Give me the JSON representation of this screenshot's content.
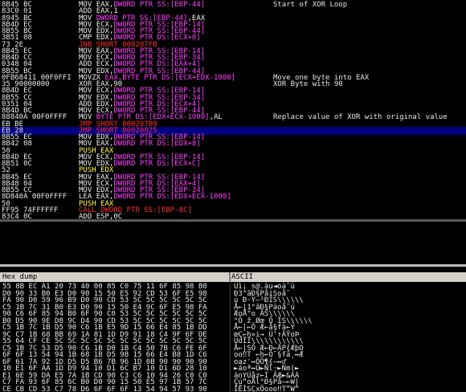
{
  "disassembly": [
    {
      "addr": "8B45 BC",
      "hex": "",
      "ins": [
        [
          "MOV ",
          "#f0f0f0"
        ],
        [
          "EAX,",
          "#f0f0f0"
        ],
        [
          "DWORD PTR SS:[EBP-44]",
          "#ff40ff"
        ]
      ],
      "comment": "Start of XOR Loop"
    },
    {
      "addr": "83C0 01",
      "hex": "",
      "ins": [
        [
          "ADD ",
          "#f0f0f0"
        ],
        [
          "EAX,1",
          "#f0f0f0"
        ]
      ],
      "comment": ""
    },
    {
      "addr": "8945 BC",
      "hex": "",
      "ins": [
        [
          "MOV ",
          "#f0f0f0"
        ],
        [
          "DWORD PTR SS:[EBP-44]",
          "#ff40ff"
        ],
        [
          ",EAX",
          "#f0f0f0"
        ]
      ],
      "comment": ""
    },
    {
      "addr": "8B4D EC",
      "hex": "",
      "ins": [
        [
          "MOV ",
          "#f0f0f0"
        ],
        [
          "ECX,",
          "#f0f0f0"
        ],
        [
          "DWORD PTR SS:[EBP-14]",
          "#ff40ff"
        ]
      ],
      "comment": ""
    },
    {
      "addr": "8B55 BC",
      "hex": "",
      "ins": [
        [
          "MOV ",
          "#f0f0f0"
        ],
        [
          "EDX,",
          "#f0f0f0"
        ],
        [
          "DWORD PTR SS:[EBP-44]",
          "#ff40ff"
        ]
      ],
      "comment": ""
    },
    {
      "addr": "3B51 08",
      "hex": "",
      "ins": [
        [
          "CMP ",
          "#f0f0f0"
        ],
        [
          "EDX,",
          "#f0f0f0"
        ],
        [
          "DWORD PTR DS:[ECX+8]",
          "#ff40ff"
        ]
      ],
      "comment": ""
    },
    {
      "addr": "73 2E",
      "hex": "",
      "ins": [
        [
          "JNB SHORT 000207FB",
          "#ff3030"
        ]
      ],
      "comment": ""
    },
    {
      "addr": "8B45 EC",
      "hex": "",
      "ins": [
        [
          "MOV ",
          "#f0f0f0"
        ],
        [
          "EAX,",
          "#f0f0f0"
        ],
        [
          "DWORD PTR SS:[EBP-14]",
          "#ff40ff"
        ]
      ],
      "comment": ""
    },
    {
      "addr": "8B4D CC",
      "hex": "",
      "ins": [
        [
          "MOV ",
          "#f0f0f0"
        ],
        [
          "ECX,",
          "#f0f0f0"
        ],
        [
          "DWORD PTR SS:[EBP-34]",
          "#ff40ff"
        ]
      ],
      "comment": ""
    },
    {
      "addr": "0348 04",
      "hex": "",
      "ins": [
        [
          "ADD ",
          "#f0f0f0"
        ],
        [
          "ECX,",
          "#f0f0f0"
        ],
        [
          "DWORD PTR DS:[EAX+4]",
          "#ff40ff"
        ]
      ],
      "comment": ""
    },
    {
      "addr": "8B55 BC",
      "hex": "",
      "ins": [
        [
          "MOV ",
          "#f0f0f0"
        ],
        [
          "EDX,",
          "#f0f0f0"
        ],
        [
          "DWORD PTR SS:[EBP-44]",
          "#ff40ff"
        ]
      ],
      "comment": ""
    },
    {
      "addr": "0FB68411 00F0FFI",
      "hex": "",
      "ins": [
        [
          "MOVZX ",
          "#f0f0f0"
        ],
        [
          "EAX,BYTE PTR DS:[ECX+EDX-1000]",
          "#ff40ff"
        ]
      ],
      "comment": "Move one byte into EAX"
    },
    {
      "addr": "35 90000000",
      "hex": "",
      "ins": [
        [
          "XOR ",
          "#f0f0f0"
        ],
        [
          "EAX,90",
          "#f0f0f0"
        ]
      ],
      "comment": "XOR Byte with 90"
    },
    {
      "addr": "8B4D EC",
      "hex": "",
      "ins": [
        [
          "MOV ",
          "#f0f0f0"
        ],
        [
          "ECX,",
          "#f0f0f0"
        ],
        [
          "DWORD PTR SS:[EBP-14]",
          "#ff40ff"
        ]
      ],
      "comment": ""
    },
    {
      "addr": "8B55 CC",
      "hex": "",
      "ins": [
        [
          "MOV ",
          "#f0f0f0"
        ],
        [
          "EDX,",
          "#f0f0f0"
        ],
        [
          "DWORD PTR SS:[EBP-34]",
          "#ff40ff"
        ]
      ],
      "comment": ""
    },
    {
      "addr": "0351 04",
      "hex": "",
      "ins": [
        [
          "ADD ",
          "#f0f0f0"
        ],
        [
          "EDX,",
          "#f0f0f0"
        ],
        [
          "DWORD PTR DS:[ECX+4]",
          "#ff40ff"
        ]
      ],
      "comment": ""
    },
    {
      "addr": "8B4D BC",
      "hex": "",
      "ins": [
        [
          "MOV ",
          "#f0f0f0"
        ],
        [
          "ECX,",
          "#f0f0f0"
        ],
        [
          "DWORD PTR SS:[EBP-44]",
          "#ff40ff"
        ]
      ],
      "comment": ""
    },
    {
      "addr": "88840A 00F0FFFF",
      "hex": "",
      "ins": [
        [
          "MOV ",
          "#f0f0f0"
        ],
        [
          "BYTE PTR DS:[EDX+ECX-1000]",
          "#ff40ff"
        ],
        [
          ",AL",
          "#f0f0f0"
        ]
      ],
      "comment": "Replace value of XOR with original value"
    },
    {
      "addr": "EB BE",
      "hex": "",
      "ins": [
        [
          "JMP SHORT 000207B9",
          "#ff3030"
        ]
      ],
      "comment": ""
    },
    {
      "addr": "EB 28",
      "hex": "",
      "ins": [
        [
          "JMP SHORT 00020825",
          "#ff3030"
        ]
      ],
      "comment": "",
      "selected": true
    },
    {
      "addr": "8B55 EC",
      "hex": "",
      "ins": [
        [
          "MOV ",
          "#f0f0f0"
        ],
        [
          "EDX,",
          "#f0f0f0"
        ],
        [
          "DWORD PTR SS:[EBP-14]",
          "#ff40ff"
        ]
      ],
      "comment": ""
    },
    {
      "addr": "8B42 08",
      "hex": "",
      "ins": [
        [
          "MOV ",
          "#f0f0f0"
        ],
        [
          "EAX,",
          "#f0f0f0"
        ],
        [
          "DWORD PTR DS:[EDX+8]",
          "#ff40ff"
        ]
      ],
      "comment": ""
    },
    {
      "addr": "50",
      "hex": "",
      "ins": [
        [
          "PUSH EAX",
          "#ffff40"
        ]
      ],
      "comment": ""
    },
    {
      "addr": "8B4D EC",
      "hex": "",
      "ins": [
        [
          "MOV ",
          "#f0f0f0"
        ],
        [
          "ECX,",
          "#f0f0f0"
        ],
        [
          "DWORD PTR SS:[EBP-14]",
          "#ff40ff"
        ]
      ],
      "comment": ""
    },
    {
      "addr": "8B51 0C",
      "hex": "",
      "ins": [
        [
          "MOV ",
          "#f0f0f0"
        ],
        [
          "EDX,",
          "#f0f0f0"
        ],
        [
          "DWORD PTR DS:[ECX+C]",
          "#ff40ff"
        ]
      ],
      "comment": ""
    },
    {
      "addr": "52",
      "hex": "",
      "ins": [
        [
          "PUSH EDX",
          "#ffff40"
        ]
      ],
      "comment": ""
    },
    {
      "addr": "8B45 EC",
      "hex": "",
      "ins": [
        [
          "MOV ",
          "#f0f0f0"
        ],
        [
          "EAX,",
          "#f0f0f0"
        ],
        [
          "DWORD PTR SS:[EBP-14]",
          "#ff40ff"
        ]
      ],
      "comment": ""
    },
    {
      "addr": "8B48 04",
      "hex": "",
      "ins": [
        [
          "MOV ",
          "#f0f0f0"
        ],
        [
          "ECX,",
          "#f0f0f0"
        ],
        [
          "DWORD PTR DS:[EAX+4]",
          "#ff40ff"
        ]
      ],
      "comment": ""
    },
    {
      "addr": "8B55 CC",
      "hex": "",
      "ins": [
        [
          "MOV ",
          "#f0f0f0"
        ],
        [
          "EDX,",
          "#f0f0f0"
        ],
        [
          "DWORD PTR SS:[EBP-34]",
          "#ff40ff"
        ]
      ],
      "comment": ""
    },
    {
      "addr": "8D840A 00F0FFFF",
      "hex": "",
      "ins": [
        [
          "LEA ",
          "#f0f0f0"
        ],
        [
          "EAX,",
          "#f0f0f0"
        ],
        [
          "DWORD PTR DS:[EDX+ECX-1000]",
          "#ff40ff"
        ]
      ],
      "comment": ""
    },
    {
      "addr": "50",
      "hex": "",
      "ins": [
        [
          "PUSH EAX",
          "#ffff40"
        ]
      ],
      "comment": ""
    },
    {
      "addr": "FF95 74FFFFFF",
      "hex": "",
      "ins": [
        [
          "CALL ",
          "#ff3030"
        ],
        [
          "DWORD PTR SS:[EBP-8C]",
          "#ff3030"
        ]
      ],
      "comment": ""
    },
    {
      "addr": "83C4 0C",
      "hex": "",
      "ins": [
        [
          "ADD ",
          "#f0f0f0"
        ],
        [
          "ESP,0C",
          "#f0f0f0"
        ]
      ],
      "comment": ""
    }
  ],
  "colors": {
    "mnemonic": "#f0f0f0",
    "memory": "#ff40ff",
    "jump": "#ff3030",
    "push": "#ffff40",
    "selected_bg": "#000080"
  },
  "dump_header": {
    "hex": "Hex dump",
    "ascii": "ASCII"
  },
  "dump": [
    {
      "hex": "55 8B EC A1 20 73 40 00 85 C0 75 11 6F 85 98 B0",
      "ascii": "Uì¡ s@.àu◄oà˜ü"
    },
    {
      "hex": "D0 90 33 B0 E3 D0 90 15 50 E5 92 CD 53 6F E5 98",
      "ascii": "Ð3°ãÐ§Påí­Soå˜"
    },
    {
      "hex": "FA 90 D0 59 96 B9 D0 90 CD 53 5C 5C 5C 5C 5C 5C",
      "ascii": "ú Ð·Y–¹ÐÍS\\\\\\\\\\\\"
    },
    {
      "hex": "C5 1B 7C 31 B0 E3 D0 90 15 50 E4 9C 6F E5 98 FA",
      "ascii": "Å←|1°ãÐ§Pä­oå˜ú"
    },
    {
      "hex": "90 C6 6F 85 94 B0 6F 90 C0 53 5C 5C 5C 5C 5C 5C",
      "ascii": "ÆoÅ°o ÀS\\\\\\\\\\\\"
    },
    {
      "hex": "B0 D5 90 9E D8 9C D4 90 CD 53 5C 5C 5C 5C 5C 5C",
      "ascii": "°Õ ž Øœ Ô ÍS\\\\\\\\\\\\"
    },
    {
      "hex": "C5 1B 7C 1B D5 90 C6 1B E5 9D 15 66 E4 85 1B DD",
      "ascii": "Å←|←Õ Æ←å§fä←Ý"
    },
    {
      "hex": "9C C7 1B 68 BB 69 1A 81 1D D9 91 18 C4 9F 6F DE",
      "ascii": "œÇ←h»i→ Ù‘↑ÄŸoÞ"
    },
    {
      "hex": "55 64 CF CE 5C 5C 5C 5C 5C 5C 5C 5C 5C 5C 5C 5C",
      "ascii": "UdÏÎ\\\\\\\\\\\\\\\\\\\\\\\\"
    },
    {
      "hex": "C5 1B 7C 53 D5 90 C6 1B D0 1B C4 50 7B C6 FE 6F",
      "ascii": "Å←|SÕ Æ←Ð←ÄP{ÆþO"
    },
    {
      "hex": "6F 6F 13 54 94 1B 68 1B D5 98 15 66 E4 B8 1D C6",
      "ascii": "oo‼T ←h←Õ˜§fä¸↔Æ"
    },
    {
      "hex": "6F 61 7A 92 1D D5 D5 B6 7B 96 1D 0B 90 90 90 90",
      "ascii": "oaz'↔ÕÕ¶{–↔♂"
    },
    {
      "hex": "10 E1 6F AA 1D D9 94 10 D1 6C B7 10 D1 6D 28 10",
      "ascii": "►áoª↔Ù►Ñl·►Ñm(►"
    },
    {
      "hex": "E1 6E 59 DA E5 7A 1B CD 90 C3 C6 10 94 26 C0 C0",
      "ascii": "ánYÚåz←Í ÃÆ►&ÀÀ"
    },
    {
      "hex": "C7 FA 93 6F 85 6C B0 D0 90 15 50 E5 97 1B 57 7C",
      "ascii": "Çú“oÅl°Ð§På—←W|"
    },
    {
      "hex": "CE CB CD 53 C7 78 D6 6F 6F 6F 13 54 94 57 93 90",
      "ascii": "ÎËÍSÇxÖooo‼T”W“"
    }
  ]
}
